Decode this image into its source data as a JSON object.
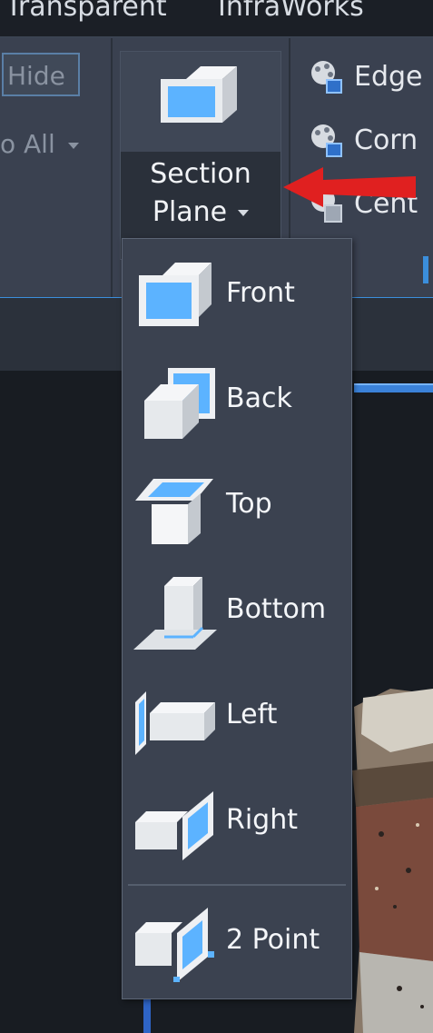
{
  "tabs": [
    {
      "label": "Transparent"
    },
    {
      "label": "InfraWorks"
    }
  ],
  "ribbon": {
    "hide_label": "Hide",
    "show_all_label": "o All",
    "section_plane": {
      "line1": "Section",
      "line2": "Plane"
    },
    "right_items": [
      {
        "label": "Edge",
        "icon": "edge-icon"
      },
      {
        "label": "Corn",
        "icon": "corner-icon"
      },
      {
        "label": "Cent",
        "icon": "center-icon"
      }
    ]
  },
  "menu": {
    "items": [
      {
        "label": "Front",
        "icon": "section-front-icon"
      },
      {
        "label": "Back",
        "icon": "section-back-icon"
      },
      {
        "label": "Top",
        "icon": "section-top-icon"
      },
      {
        "label": "Bottom",
        "icon": "section-bottom-icon"
      },
      {
        "label": "Left",
        "icon": "section-left-icon"
      },
      {
        "label": "Right",
        "icon": "section-right-icon"
      },
      {
        "label": "2 Point",
        "icon": "section-2point-icon"
      }
    ]
  },
  "colors": {
    "accent_blue": "#3b8edc",
    "plane_blue": "#5cb3ff",
    "annotation_red": "#e02020",
    "menu_bg": "#3b4250",
    "ribbon_bg": "#3a4150"
  }
}
